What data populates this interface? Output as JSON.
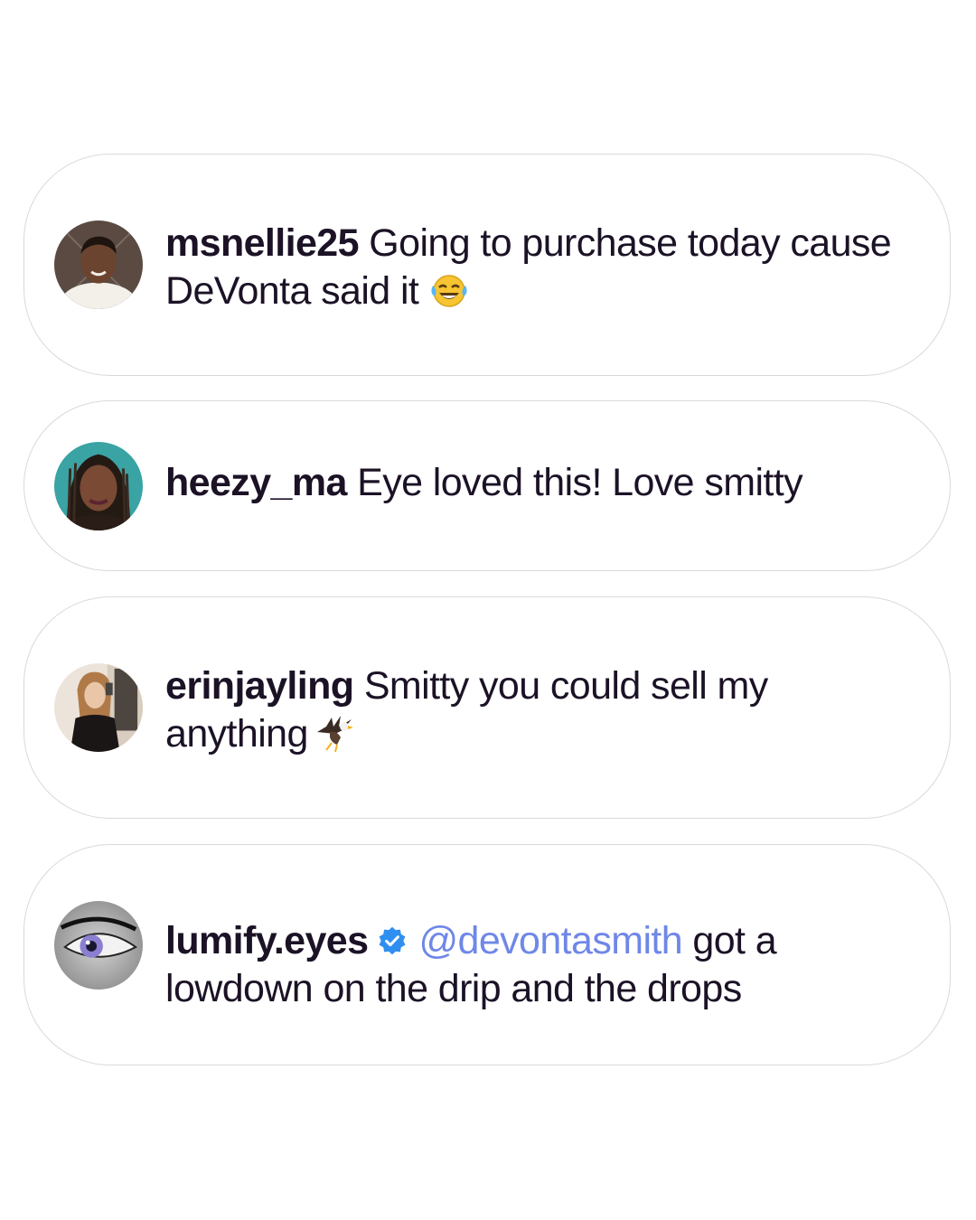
{
  "comments": [
    {
      "username": "msnellie25",
      "text_line1": "Going to purchase today cause",
      "text_line2": "DeVonta said it",
      "emoji": "face-with-tears-of-joy"
    },
    {
      "username": "heezy_ma",
      "text_line1": "Eye loved this! Love smitty"
    },
    {
      "username": "erinjayling",
      "text_line1": "Smitty you could sell my",
      "text_line2": "anything",
      "emoji": "eagle"
    },
    {
      "username": "lumify.eyes",
      "verified": true,
      "mention": "@devontasmith",
      "text_line1": "got a",
      "text_line2": "lowdown on the drip and the drops"
    }
  ],
  "colors": {
    "text": "#1c1226",
    "mention": "#6f87e8",
    "verified_badge": "#2f8ff0",
    "card_border": "#d9d9d9"
  }
}
